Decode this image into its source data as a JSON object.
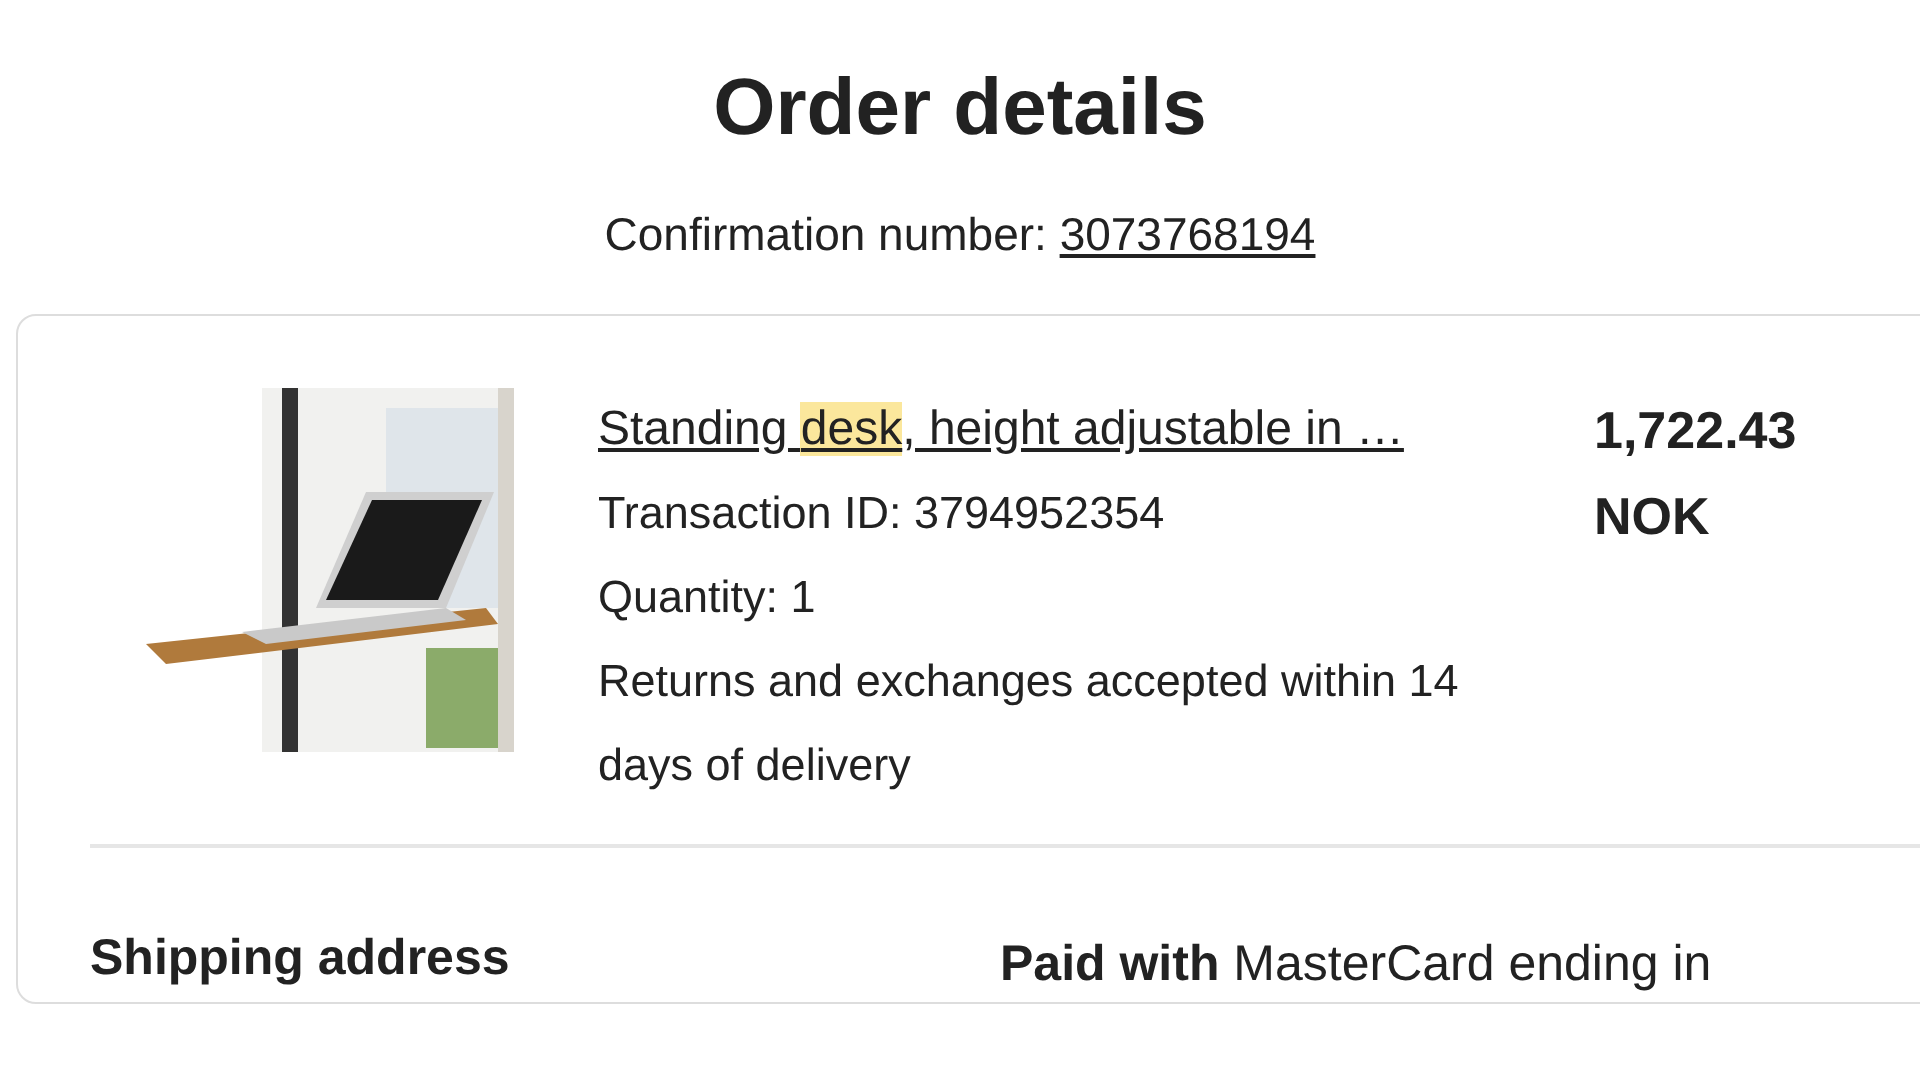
{
  "page": {
    "title": "Order details",
    "confirmation_label": "Confirmation number:",
    "confirmation_number": "3073768194"
  },
  "item": {
    "title_parts": [
      {
        "text": "Standing ",
        "highlighted": false
      },
      {
        "text": "desk",
        "highlighted": true
      },
      {
        "text": ", height adjustable in …",
        "highlighted": false
      }
    ],
    "transaction": "Transaction ID: 3794952354",
    "quantity": "Quantity: 1",
    "returns": "Returns and exchanges accepted within 14 days of delivery",
    "price": "1,722.43 NOK"
  },
  "shipping": {
    "heading": "Shipping address"
  },
  "payment": {
    "text": "**Paid with** MasterCard ending in"
  }
}
